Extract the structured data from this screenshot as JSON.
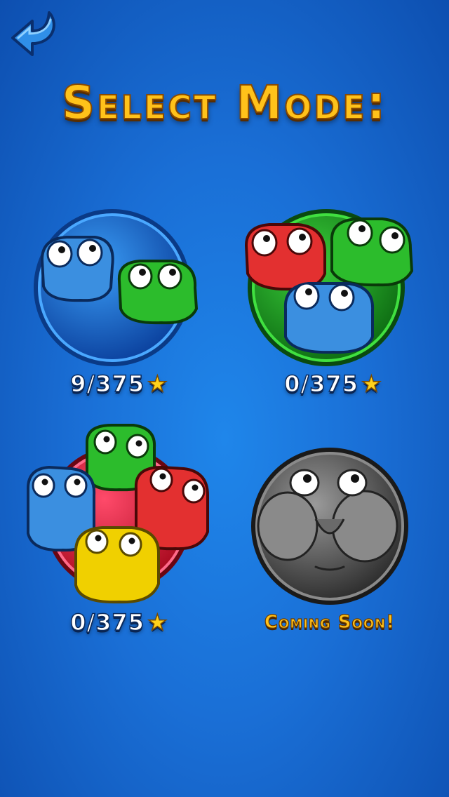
{
  "header": {
    "title": "Select Mode:",
    "back_icon": "back-arrow-icon"
  },
  "modes": [
    {
      "id": "two-color",
      "progress": "9/375",
      "star_icon": "star-icon",
      "colors": [
        "#3b8fe0",
        "#2cbc2c"
      ]
    },
    {
      "id": "three-color",
      "progress": "0/375",
      "star_icon": "star-icon",
      "colors": [
        "#e33030",
        "#2cbc2c",
        "#3b8fe0"
      ]
    },
    {
      "id": "four-color",
      "progress": "0/375",
      "star_icon": "star-icon",
      "colors": [
        "#2cbc2c",
        "#3b8fe0",
        "#e33030",
        "#f0d000"
      ]
    },
    {
      "id": "locked",
      "status": "Coming Soon!"
    }
  ],
  "theme": {
    "accent": "#ffc21a",
    "background": "#1a6fd6"
  }
}
